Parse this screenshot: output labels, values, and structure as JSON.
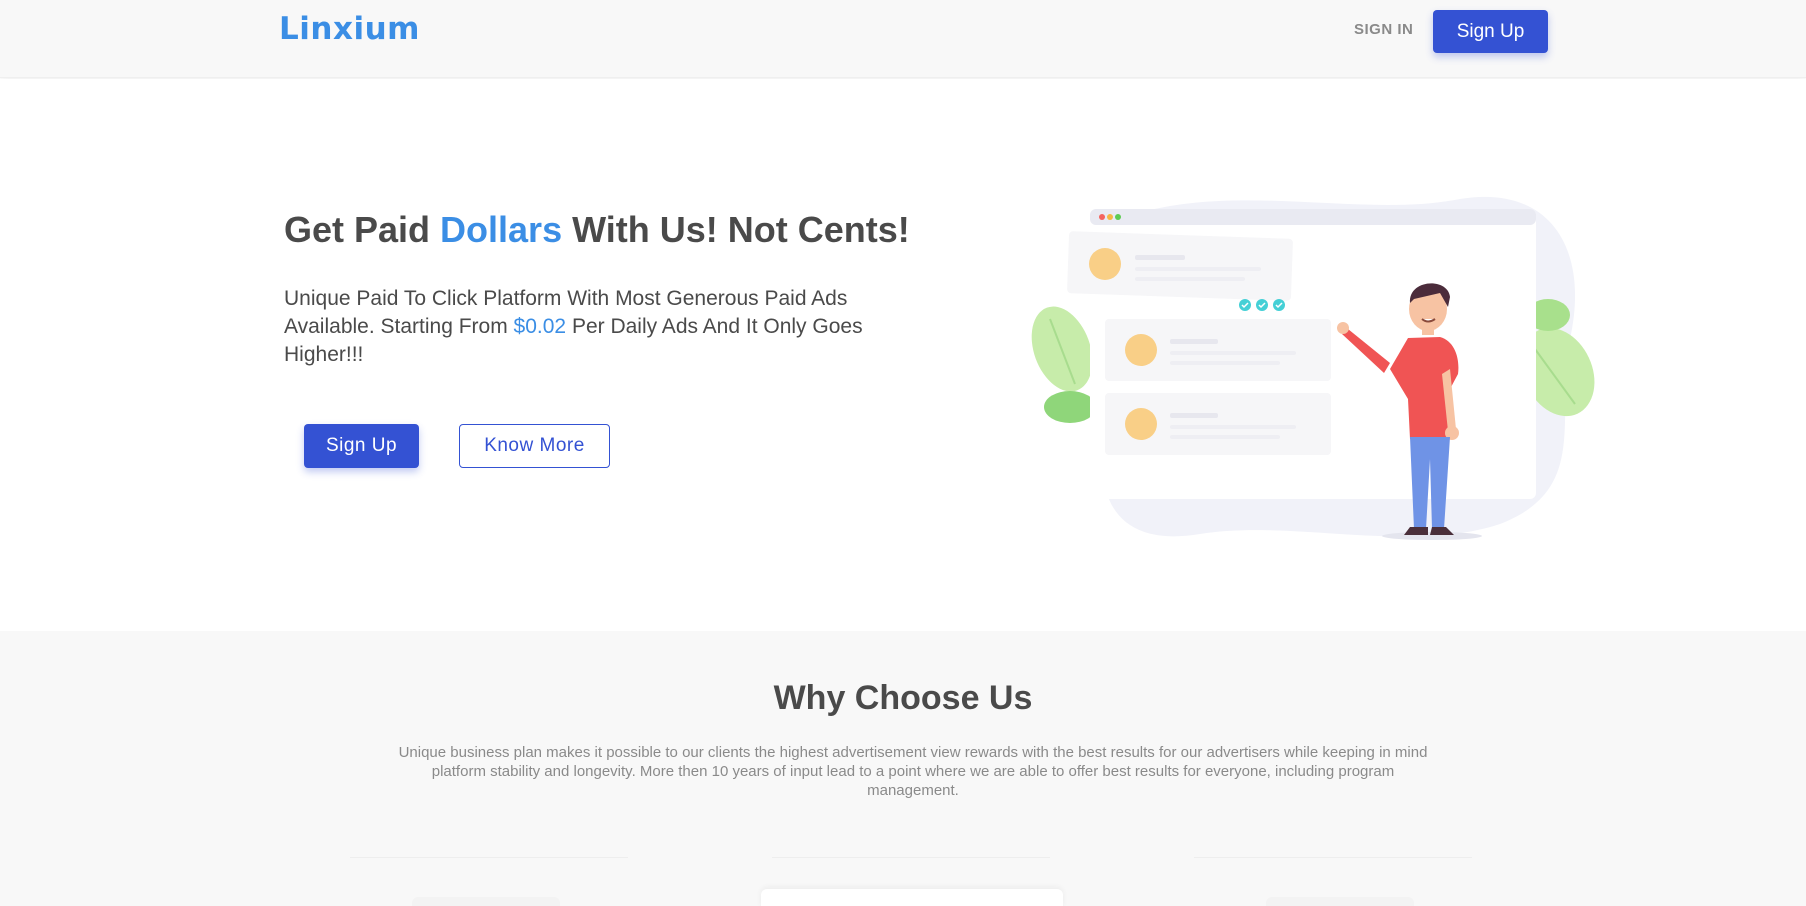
{
  "header": {
    "logo": "Linxium",
    "signin_label": "SIGN IN",
    "signup_label": "Sign Up"
  },
  "hero": {
    "title_part1": "Get Paid ",
    "title_accent": "Dollars",
    "title_part2": " With Us! Not Cents!",
    "subtitle_part1": "Unique Paid To Click Platform With Most Generous Paid Ads Available. Starting From ",
    "subtitle_price": "$0.02",
    "subtitle_part2": " Per Daily Ads And It Only Goes Higher!!!",
    "signup_label": "Sign Up",
    "know_more_label": "Know More"
  },
  "why": {
    "title": "Why Choose Us",
    "text": "Unique business plan makes it possible to our clients the highest advertisement view rewards with the best results for our advertisers while keeping in mind platform stability and longevity. More then 10 years of input lead to a point where we are able to offer best results for everyone, including program management."
  },
  "colors": {
    "accent": "#3b8ee5",
    "primary_button": "#3452d3",
    "text": "#4a4a4a"
  },
  "icons": [
    "hero-illustration"
  ]
}
